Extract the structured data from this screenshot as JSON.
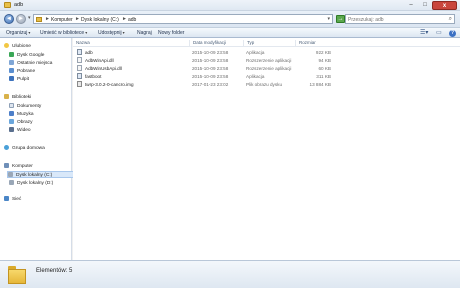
{
  "window": {
    "title": "adb",
    "close_label": "x",
    "min_label": "–",
    "max_label": "□"
  },
  "address": {
    "crumbs": [
      "Komputer",
      "Dysk lokalny (C:)",
      "adb"
    ],
    "separator": "►",
    "search_placeholder": "Przeszukaj: adb"
  },
  "toolbar": {
    "items": [
      "Organizuj",
      "Umieść w bibliotece",
      "Udostępnij",
      "Nagraj",
      "Nowy folder"
    ]
  },
  "sidebar": {
    "favorites": {
      "label": "Ulubione",
      "items": [
        "Dysk Google",
        "Ostatnie miejsca",
        "Pobrane",
        "Pulpit"
      ]
    },
    "libraries": {
      "label": "Biblioteki",
      "items": [
        "Dokumenty",
        "Muzyka",
        "Obrazy",
        "Wideo"
      ]
    },
    "homegroup": {
      "label": "Grupa domowa"
    },
    "computer": {
      "label": "Komputer",
      "items": [
        "Dysk lokalny (C:)",
        "Dysk lokalny (D:)"
      ]
    },
    "network": {
      "label": "Sieć"
    }
  },
  "columns": [
    "Nazwa",
    "Data modyfikacji",
    "Typ",
    "Rozmiar"
  ],
  "files": [
    {
      "name": "adb",
      "date": "2015-10-09 23:58",
      "type": "Aplikacja",
      "size": "922 KB",
      "icon": "exe"
    },
    {
      "name": "AdbWinApi.dll",
      "date": "2015-10-09 23:58",
      "type": "Rozszerzenie aplikacji",
      "size": "94 KB",
      "icon": "dll"
    },
    {
      "name": "AdbWinUsbApi.dll",
      "date": "2015-10-09 23:58",
      "type": "Rozszerzenie aplikacji",
      "size": "60 KB",
      "icon": "dll"
    },
    {
      "name": "fastboot",
      "date": "2015-10-09 23:58",
      "type": "Aplikacja",
      "size": "311 KB",
      "icon": "exe"
    },
    {
      "name": "twrp-3.0.2-0-cancro.img",
      "date": "2017-01-23 23:02",
      "type": "Plik obrazu dysku",
      "size": "13 884 KB",
      "icon": "img"
    }
  ],
  "status": {
    "summary": "Elementów: 5"
  }
}
